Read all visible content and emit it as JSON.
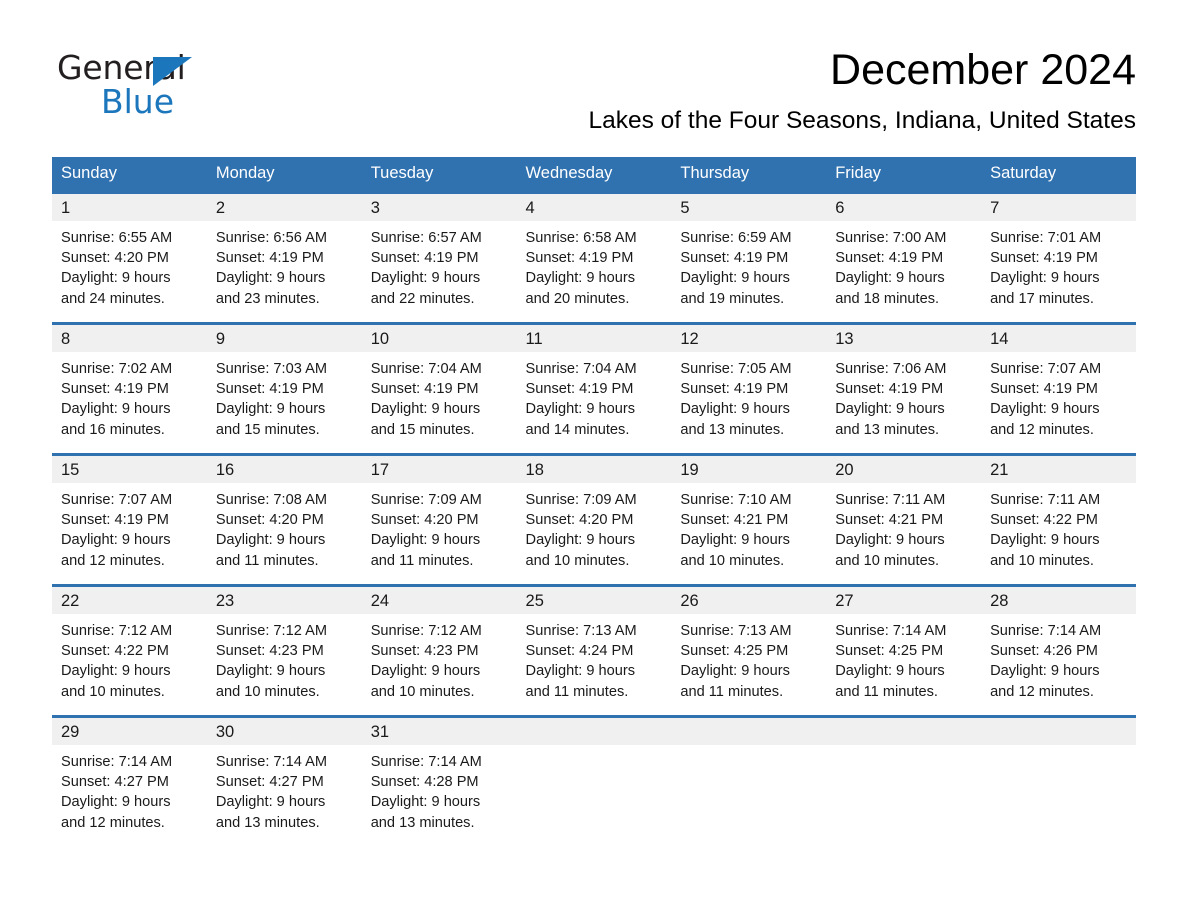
{
  "brand": {
    "name_part1": "General",
    "name_part2": "Blue",
    "triangle_color": "#1b76bc"
  },
  "header": {
    "month_title": "December 2024",
    "location": "Lakes of the Four Seasons, Indiana, United States"
  },
  "colors": {
    "header_blue": "#3071b0",
    "row_border_blue": "#3071b0",
    "daynum_band": "#f0f0f0",
    "text": "#1a1a1a"
  },
  "calendar": {
    "weekday_headers": [
      "Sunday",
      "Monday",
      "Tuesday",
      "Wednesday",
      "Thursday",
      "Friday",
      "Saturday"
    ],
    "weeks": [
      [
        {
          "day": "1",
          "info": "Sunrise: 6:55 AM\nSunset: 4:20 PM\nDaylight: 9 hours\nand 24 minutes."
        },
        {
          "day": "2",
          "info": "Sunrise: 6:56 AM\nSunset: 4:19 PM\nDaylight: 9 hours\nand 23 minutes."
        },
        {
          "day": "3",
          "info": "Sunrise: 6:57 AM\nSunset: 4:19 PM\nDaylight: 9 hours\nand 22 minutes."
        },
        {
          "day": "4",
          "info": "Sunrise: 6:58 AM\nSunset: 4:19 PM\nDaylight: 9 hours\nand 20 minutes."
        },
        {
          "day": "5",
          "info": "Sunrise: 6:59 AM\nSunset: 4:19 PM\nDaylight: 9 hours\nand 19 minutes."
        },
        {
          "day": "6",
          "info": "Sunrise: 7:00 AM\nSunset: 4:19 PM\nDaylight: 9 hours\nand 18 minutes."
        },
        {
          "day": "7",
          "info": "Sunrise: 7:01 AM\nSunset: 4:19 PM\nDaylight: 9 hours\nand 17 minutes."
        }
      ],
      [
        {
          "day": "8",
          "info": "Sunrise: 7:02 AM\nSunset: 4:19 PM\nDaylight: 9 hours\nand 16 minutes."
        },
        {
          "day": "9",
          "info": "Sunrise: 7:03 AM\nSunset: 4:19 PM\nDaylight: 9 hours\nand 15 minutes."
        },
        {
          "day": "10",
          "info": "Sunrise: 7:04 AM\nSunset: 4:19 PM\nDaylight: 9 hours\nand 15 minutes."
        },
        {
          "day": "11",
          "info": "Sunrise: 7:04 AM\nSunset: 4:19 PM\nDaylight: 9 hours\nand 14 minutes."
        },
        {
          "day": "12",
          "info": "Sunrise: 7:05 AM\nSunset: 4:19 PM\nDaylight: 9 hours\nand 13 minutes."
        },
        {
          "day": "13",
          "info": "Sunrise: 7:06 AM\nSunset: 4:19 PM\nDaylight: 9 hours\nand 13 minutes."
        },
        {
          "day": "14",
          "info": "Sunrise: 7:07 AM\nSunset: 4:19 PM\nDaylight: 9 hours\nand 12 minutes."
        }
      ],
      [
        {
          "day": "15",
          "info": "Sunrise: 7:07 AM\nSunset: 4:19 PM\nDaylight: 9 hours\nand 12 minutes."
        },
        {
          "day": "16",
          "info": "Sunrise: 7:08 AM\nSunset: 4:20 PM\nDaylight: 9 hours\nand 11 minutes."
        },
        {
          "day": "17",
          "info": "Sunrise: 7:09 AM\nSunset: 4:20 PM\nDaylight: 9 hours\nand 11 minutes."
        },
        {
          "day": "18",
          "info": "Sunrise: 7:09 AM\nSunset: 4:20 PM\nDaylight: 9 hours\nand 10 minutes."
        },
        {
          "day": "19",
          "info": "Sunrise: 7:10 AM\nSunset: 4:21 PM\nDaylight: 9 hours\nand 10 minutes."
        },
        {
          "day": "20",
          "info": "Sunrise: 7:11 AM\nSunset: 4:21 PM\nDaylight: 9 hours\nand 10 minutes."
        },
        {
          "day": "21",
          "info": "Sunrise: 7:11 AM\nSunset: 4:22 PM\nDaylight: 9 hours\nand 10 minutes."
        }
      ],
      [
        {
          "day": "22",
          "info": "Sunrise: 7:12 AM\nSunset: 4:22 PM\nDaylight: 9 hours\nand 10 minutes."
        },
        {
          "day": "23",
          "info": "Sunrise: 7:12 AM\nSunset: 4:23 PM\nDaylight: 9 hours\nand 10 minutes."
        },
        {
          "day": "24",
          "info": "Sunrise: 7:12 AM\nSunset: 4:23 PM\nDaylight: 9 hours\nand 10 minutes."
        },
        {
          "day": "25",
          "info": "Sunrise: 7:13 AM\nSunset: 4:24 PM\nDaylight: 9 hours\nand 11 minutes."
        },
        {
          "day": "26",
          "info": "Sunrise: 7:13 AM\nSunset: 4:25 PM\nDaylight: 9 hours\nand 11 minutes."
        },
        {
          "day": "27",
          "info": "Sunrise: 7:14 AM\nSunset: 4:25 PM\nDaylight: 9 hours\nand 11 minutes."
        },
        {
          "day": "28",
          "info": "Sunrise: 7:14 AM\nSunset: 4:26 PM\nDaylight: 9 hours\nand 12 minutes."
        }
      ],
      [
        {
          "day": "29",
          "info": "Sunrise: 7:14 AM\nSunset: 4:27 PM\nDaylight: 9 hours\nand 12 minutes."
        },
        {
          "day": "30",
          "info": "Sunrise: 7:14 AM\nSunset: 4:27 PM\nDaylight: 9 hours\nand 13 minutes."
        },
        {
          "day": "31",
          "info": "Sunrise: 7:14 AM\nSunset: 4:28 PM\nDaylight: 9 hours\nand 13 minutes."
        },
        {
          "day": "",
          "info": ""
        },
        {
          "day": "",
          "info": ""
        },
        {
          "day": "",
          "info": ""
        },
        {
          "day": "",
          "info": ""
        }
      ]
    ]
  }
}
